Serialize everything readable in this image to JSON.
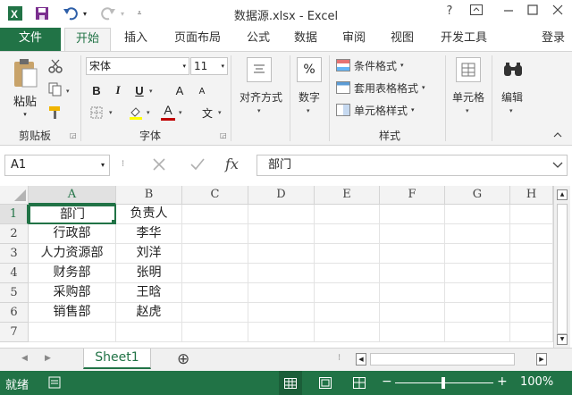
{
  "window": {
    "title": "数据源.xlsx - Excel",
    "app_icon": "X",
    "help": "?",
    "controls": [
      "restore-ribbon-icon",
      "minimize-icon",
      "maximize-icon",
      "close-icon"
    ]
  },
  "ribbon_tabs": [
    "文件",
    "开始",
    "插入",
    "页面布局",
    "公式",
    "数据",
    "审阅",
    "视图",
    "开发工具"
  ],
  "active_tab": "开始",
  "signin": "登录",
  "clipboard": {
    "paste": "粘贴",
    "group": "剪贴板"
  },
  "font": {
    "name": "宋体",
    "size": "11",
    "bold": "B",
    "italic": "I",
    "underline": "U",
    "grow": "A",
    "shrink": "A",
    "color_letter": "A",
    "wen": "文",
    "group": "字体"
  },
  "alignment": {
    "label": "对齐方式"
  },
  "number": {
    "label": "数字",
    "icon": "%"
  },
  "styles": {
    "conditional": "条件格式",
    "table": "套用表格格式",
    "cell": "单元格样式",
    "group": "样式"
  },
  "cells": {
    "label": "单元格"
  },
  "editing": {
    "label": "编辑"
  },
  "formula_bar": {
    "namebox": "A1",
    "fx": "fx",
    "content": "部门"
  },
  "columns": [
    "A",
    "B",
    "C",
    "D",
    "E",
    "F",
    "G",
    "H"
  ],
  "rows": [
    "1",
    "2",
    "3",
    "4",
    "5",
    "6",
    "7"
  ],
  "table": [
    [
      "部门",
      "负责人"
    ],
    [
      "行政部",
      "李华"
    ],
    [
      "人力资源部",
      "刘洋"
    ],
    [
      "财务部",
      "张明"
    ],
    [
      "采购部",
      "王晗"
    ],
    [
      "销售部",
      "赵虎"
    ]
  ],
  "sheet": {
    "name": "Sheet1",
    "add": "⊕"
  },
  "status": {
    "ready": "就绪",
    "zoom": "100%",
    "minus": "−",
    "plus": "+"
  },
  "colors": {
    "accent": "#217346",
    "ribbon": "#f3f3f3",
    "header": "#f3f3f3",
    "font_red": "#c00000",
    "highlight_yellow": "#ffff00"
  }
}
